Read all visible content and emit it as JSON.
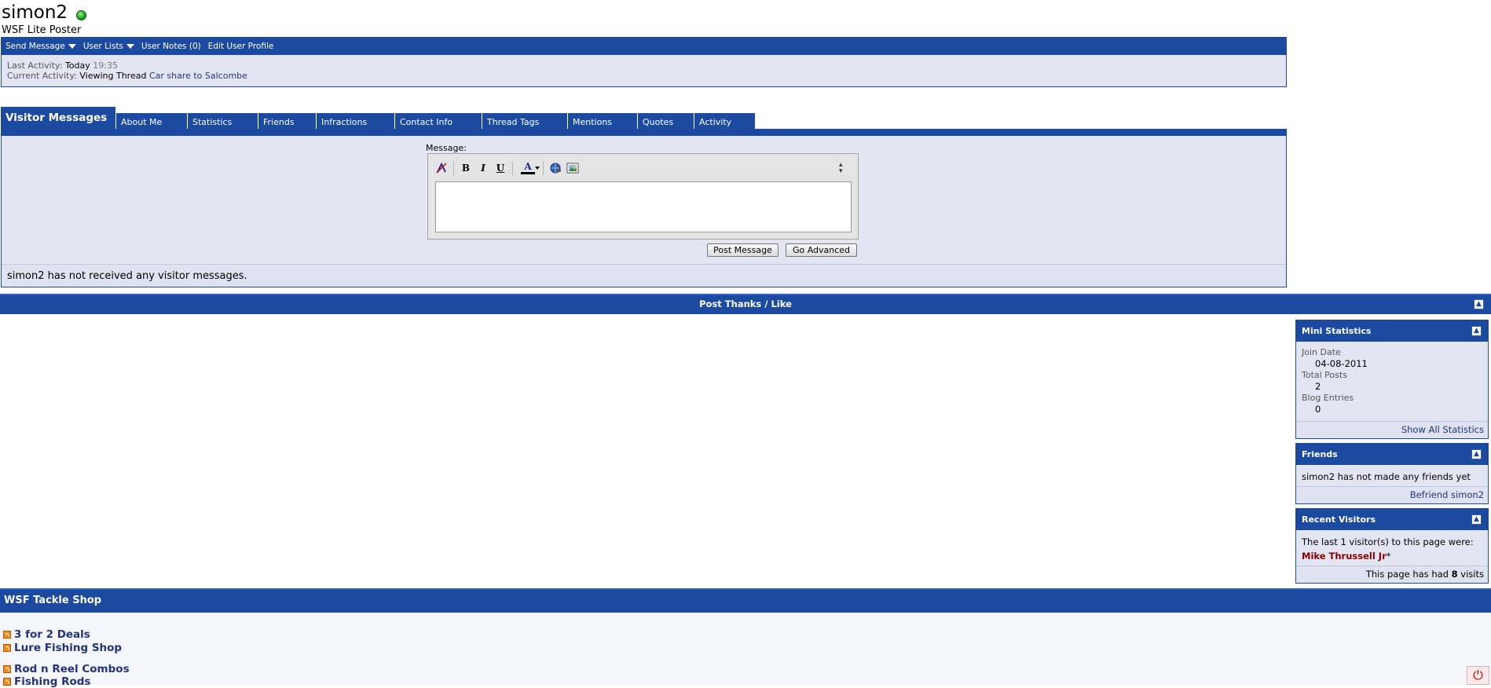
{
  "profile": {
    "username": "simon2",
    "user_title": "WSF Lite Poster",
    "menu": [
      {
        "label": "Send Message",
        "dropdown": true
      },
      {
        "label": "User Lists",
        "dropdown": true
      },
      {
        "label": "User Notes (0)",
        "dropdown": false
      },
      {
        "label": "Edit User Profile",
        "dropdown": false
      }
    ],
    "last_activity_label": "Last Activity:",
    "last_activity_day": "Today",
    "last_activity_time": "19:35",
    "current_activity_label": "Current Activity:",
    "current_activity_prefix": "Viewing Thread",
    "current_activity_thread": "Car share to Salcombe"
  },
  "tabs": [
    {
      "label": "Visitor Messages",
      "active": true
    },
    {
      "label": "About Me"
    },
    {
      "label": "Statistics"
    },
    {
      "label": "Friends"
    },
    {
      "label": "Infractions"
    },
    {
      "label": "Contact Info"
    },
    {
      "label": "Thread Tags"
    },
    {
      "label": "Mentions"
    },
    {
      "label": "Quotes"
    },
    {
      "label": "Activity"
    }
  ],
  "visitor_messages": {
    "message_label": "Message:",
    "message_value": "",
    "toolbar_icons": [
      "remove-format-icon",
      "bold-icon",
      "italic-icon",
      "underline-icon",
      "text-color-icon",
      "insert-link-icon",
      "insert-image-icon"
    ],
    "toolbar_glyphs": {
      "bold": "B",
      "italic": "I",
      "underline": "U",
      "color": "A"
    },
    "post_button": "Post Message",
    "advanced_button": "Go Advanced",
    "empty_text": "simon2 has not received any visitor messages."
  },
  "post_thanks": {
    "title": "Post Thanks / Like"
  },
  "sidebar": {
    "mini_statistics": {
      "title": "Mini Statistics",
      "join_date_label": "Join Date",
      "join_date": "04-08-2011",
      "total_posts_label": "Total Posts",
      "total_posts": "2",
      "blog_entries_label": "Blog Entries",
      "blog_entries": "0",
      "footer_link": "Show All Statistics"
    },
    "friends": {
      "title": "Friends",
      "text": "simon2 has not made any friends yet",
      "footer_link": "Befriend simon2"
    },
    "recent_visitors": {
      "title": "Recent Visitors",
      "intro": "The last 1 visitor(s) to this page were:",
      "visitor_name": "Mike Thrussell Jr",
      "visitor_suffix": "*",
      "visits_prefix": "This page has had",
      "visits_count": "8",
      "visits_suffix": "visits"
    }
  },
  "shop": {
    "title": "WSF Tackle Shop",
    "items": [
      "3 for 2 Deals",
      "Lure Fishing Shop",
      "Rod n Reel Combos",
      "Fishing Rods"
    ]
  },
  "colors": {
    "header_blue": "#1b4aa0",
    "panel_bg": "#e3e6f2",
    "link": "#22357a",
    "visitor_name": "#8b0000"
  }
}
